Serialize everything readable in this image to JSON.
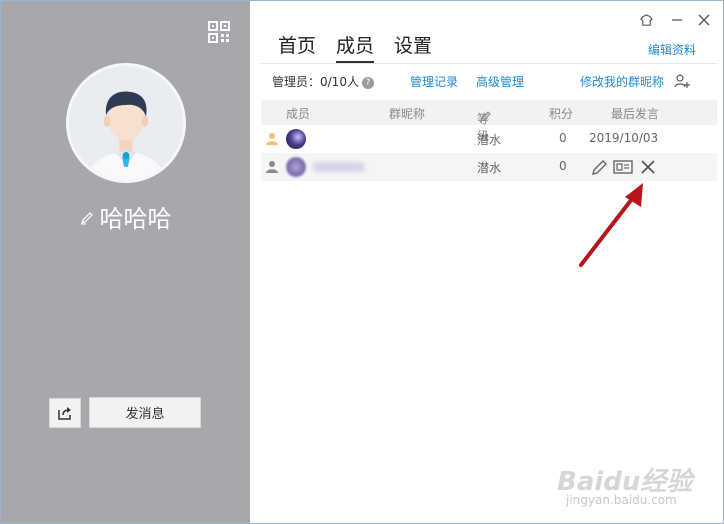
{
  "profile": {
    "name": "哈哈哈",
    "send_message_label": "发消息"
  },
  "tabs": [
    {
      "label": "首页",
      "active": false
    },
    {
      "label": "成员",
      "active": true
    },
    {
      "label": "设置",
      "active": false
    }
  ],
  "header": {
    "edit_profile_label": "编辑资料"
  },
  "admin_bar": {
    "admin_count": "管理员：0/10人",
    "manage_log_label": "管理记录",
    "advanced_manage_label": "高级管理",
    "edit_nickname_label": "修改我的群昵称"
  },
  "table": {
    "columns": [
      "成员",
      "群昵称",
      "等级",
      "积分",
      "最后发言"
    ],
    "rows": [
      {
        "level": "潜水",
        "points": "0",
        "last_message": "2019/10/03"
      },
      {
        "level": "潜水",
        "points": "0",
        "last_message": ""
      }
    ]
  },
  "watermark": {
    "brand": "Baidu经验",
    "url": "jingyan.baidu.com"
  },
  "colors": {
    "accent": "#1f8ad6",
    "left_panel": "#a6a8ab",
    "arrow": "#b5151b"
  }
}
